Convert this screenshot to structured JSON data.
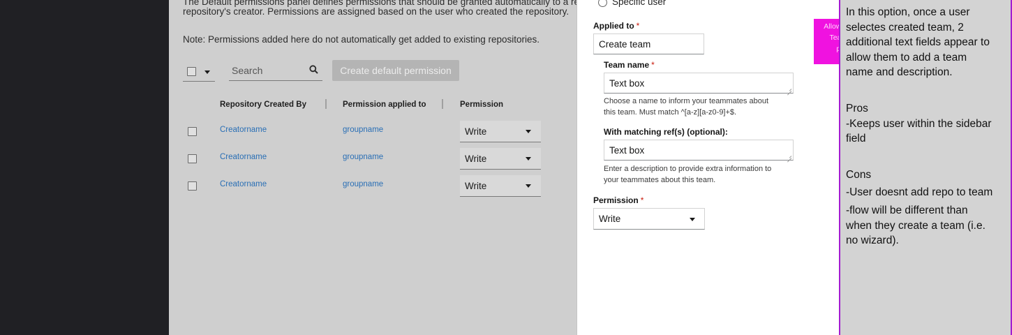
{
  "main": {
    "description_line1": "The Default permissions panel defines permissions that should be granted automatically to a re",
    "description_line2": "repository's creator. Permissions are assigned based on the user who created the repository.",
    "note": "Note: Permissions added here do not automatically get added to existing repositories.",
    "search_placeholder": "Search",
    "create_button": "Create default permission",
    "columns": [
      "Repository Created By",
      "Permission applied to",
      "Permission"
    ],
    "rows": [
      {
        "created_by": "Creatorname",
        "applied_to": "groupname",
        "permission": "Write"
      },
      {
        "created_by": "Creatorname",
        "applied_to": "groupname",
        "permission": "Write"
      },
      {
        "created_by": "Creatorname",
        "applied_to": "groupname",
        "permission": "Write"
      }
    ]
  },
  "drawer": {
    "radio_specific_user": "Specific user",
    "applied_to_label": "Applied to",
    "applied_to_value": "Create team",
    "team_name_label": "Team name",
    "team_name_value": "Text box",
    "team_name_help_1": "Choose a name to inform your teammates about",
    "team_name_help_2": "this team. Must match ^[a-z][a-z0-9]+$.",
    "matching_ref_label": "With matching ref(s) (optional):",
    "matching_ref_value": "Text box",
    "matching_ref_help_1": "Enter a description to provide extra information to",
    "matching_ref_help_2": "your teammates about this team.",
    "permission_label": "Permission",
    "permission_value": "Write",
    "required_mark": "*"
  },
  "sticky_note": {
    "line1": "Allow creation of team name.",
    "line2": "Team creates when when",
    "line3": "permission is created",
    "color": "#f012e0"
  },
  "side_panel": {
    "lines": [
      "In this option, once a user",
      "selectes created team, 2",
      "additional text fields appear to",
      "allow them to add a team",
      "name and description.",
      "",
      "Pros",
      "-Keeps user within the sidebar",
      "field",
      "",
      "Cons",
      "-User doesnt add repo to team",
      "-flow will be different than",
      "when they create a team (i.e.",
      "no wizard)."
    ],
    "border_color": "#a31cd1"
  }
}
